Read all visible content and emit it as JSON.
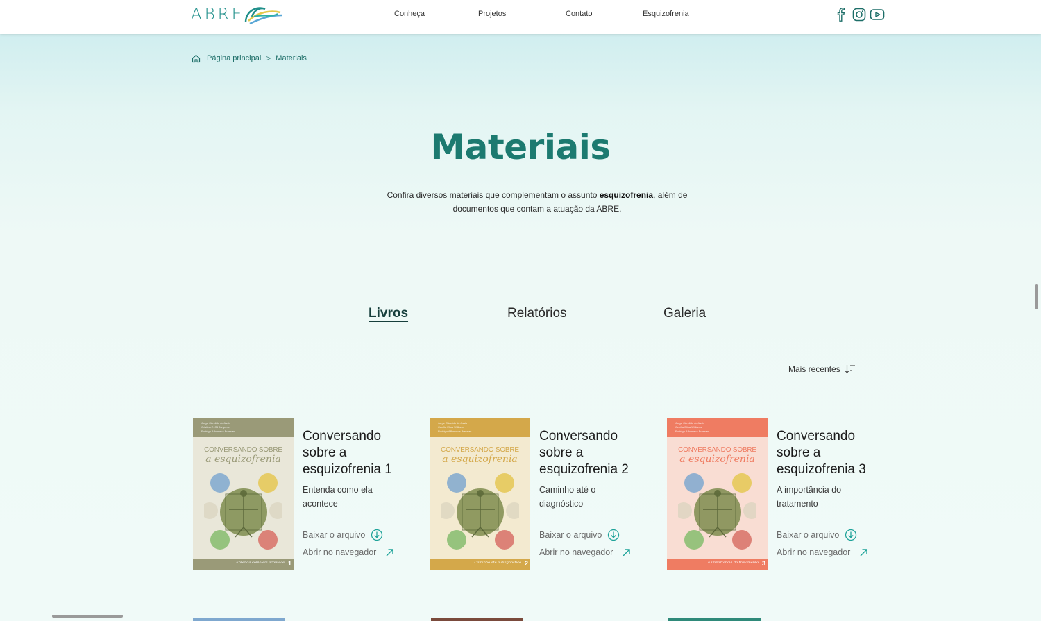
{
  "header": {
    "logo_text": "ABRE",
    "nav": [
      {
        "label": "Conheça"
      },
      {
        "label": "Projetos"
      },
      {
        "label": "Contato"
      },
      {
        "label": "Esquizofrenia"
      }
    ],
    "social_icons": [
      "facebook-icon",
      "instagram-icon",
      "youtube-icon"
    ],
    "brand_color": "#1f8f8a"
  },
  "breadcrumb": {
    "home_label": "Página principal",
    "separator": ">",
    "current": "Materiais"
  },
  "hero": {
    "title": "Materiais",
    "desc_before": "Confira diversos materiais que complementam o assunto ",
    "desc_bold": "esquizofrenia",
    "desc_after": ", além de documentos que contam a atuação da ABRE."
  },
  "tabs": [
    {
      "label": "Livros",
      "active": true
    },
    {
      "label": "Relatórios",
      "active": false
    },
    {
      "label": "Galeria",
      "active": false
    }
  ],
  "sort": {
    "label": "Mais recentes"
  },
  "books": [
    {
      "title": "Conversando sobre a esquizofrenia 1",
      "subtitle": "Entenda como ela acontece",
      "download_label": "Baixar o arquivo",
      "open_label": "Abrir no navegador",
      "cover": {
        "color": "#9a9a78",
        "light": "#e9e7d9",
        "authors": "Jorge Cândido de Assis\nCristina Z. Gil Jorge de\nRodrigo Affonseca Bressan",
        "line1": "CONVERSANDO SOBRE",
        "line2": "a esquizofrenia",
        "sub": "Entenda como ela acontece",
        "number": "1"
      }
    },
    {
      "title": "Conversando sobre a esquizofrenia 2",
      "subtitle": "Caminho até o diagnóstico",
      "download_label": "Baixar o arquivo",
      "open_label": "Abrir no navegador",
      "cover": {
        "color": "#d4a84a",
        "light": "#f3ead0",
        "authors": "Jorge Cândido de Assis\nCecília Elisa Williams\nRodrigo Affonseca Bressan",
        "line1": "CONVERSANDO SOBRE",
        "line2": "a esquizofrenia",
        "sub": "Caminho até o diagnóstico",
        "number": "2"
      }
    },
    {
      "title": "Conversando sobre a esquizofrenia 3",
      "subtitle": "A importância do tratamento",
      "download_label": "Baixar o arquivo",
      "open_label": "Abrir no navegador",
      "cover": {
        "color": "#ef7c62",
        "light": "#f9ddd3",
        "authors": "Jorge Cândido de Assis\nCecília Elisa Williams\nRodrigo Affonseca Bressan",
        "line1": "CONVERSANDO SOBRE",
        "line2": "a esquizofrenia",
        "sub": "A importância do tratamento",
        "number": "3"
      }
    }
  ]
}
